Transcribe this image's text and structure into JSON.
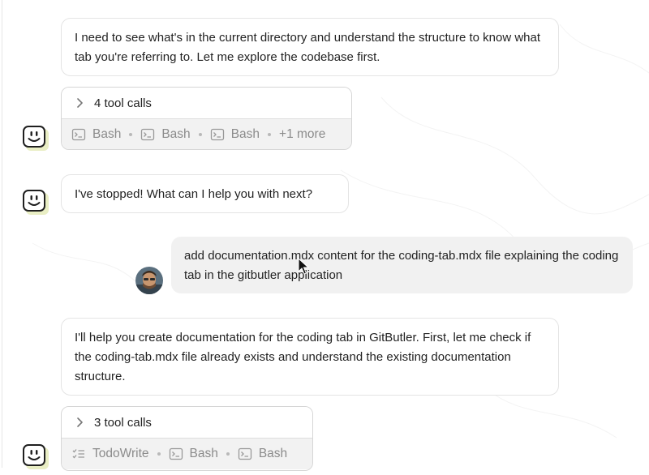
{
  "messages": {
    "m1": {
      "text": "I need to see what's in the current directory and understand the structure to know what tab you're referring to. Let me explore the codebase first."
    },
    "tools1": {
      "header": "4 tool calls",
      "items": [
        "Bash",
        "Bash",
        "Bash"
      ],
      "more": "+1 more"
    },
    "m2": {
      "text": "I've stopped! What can I help you with next?"
    },
    "user": {
      "text": "add documentation.mdx content for the coding-tab.mdx file explaining the coding tab in the gitbutler application"
    },
    "m3": {
      "text": "I'll help you create documentation for the coding tab in GitButler. First, let me check if the coding-tab.mdx file already exists and understand the existing documentation structure."
    },
    "tools2": {
      "header": "3 tool calls",
      "items": [
        "TodoWrite",
        "Bash",
        "Bash"
      ]
    }
  },
  "icons": {
    "bot_avatar": "smiley-face-icon",
    "tool_terminal": "terminal-icon",
    "tool_todo": "checklist-icon",
    "chevron": "chevron-right-icon"
  },
  "colors": {
    "bot_avatar_bg": "#e9eec4",
    "bubble_border": "#e4e4e4",
    "user_bubble_bg": "#f1f1f1",
    "tool_footer_bg": "#f2f2f2",
    "muted_text": "#8b8b8b"
  }
}
